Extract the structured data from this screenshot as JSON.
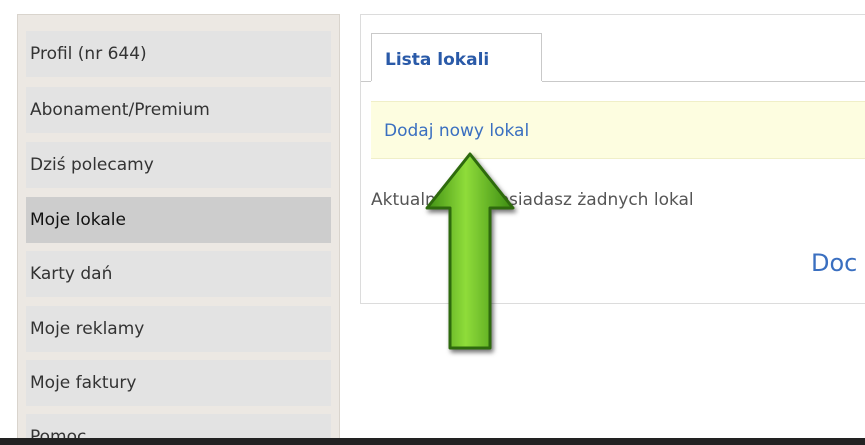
{
  "sidebar": {
    "items": [
      {
        "label": "Profil (nr 644)"
      },
      {
        "label": "Abonament/Premium"
      },
      {
        "label": "Dziś polecamy"
      },
      {
        "label": "Moje lokale",
        "active": true
      },
      {
        "label": "Karty dań"
      },
      {
        "label": "Moje reklamy"
      },
      {
        "label": "Moje faktury"
      },
      {
        "label": "Pomoc"
      }
    ]
  },
  "main": {
    "tab_label": "Lista lokali",
    "notice_link": "Dodaj nowy lokal",
    "info_text": "Aktualnie nie posiadasz żadnych lokal",
    "big_link": "Doc"
  },
  "icons": {
    "arrow": "up-arrow-icon"
  },
  "colors": {
    "arrow_green": "#5cb82a",
    "link_blue": "#3a6fc0",
    "active_item": "#cdcdcd"
  }
}
